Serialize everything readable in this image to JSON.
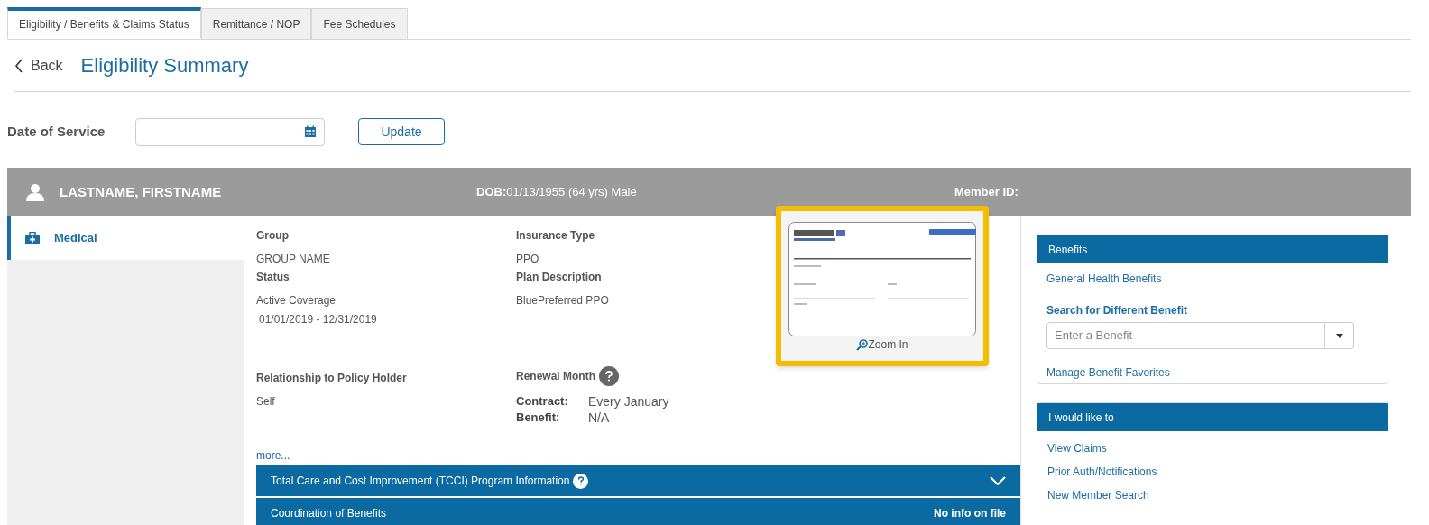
{
  "tabs": [
    {
      "label": "Eligibility / Benefits & Claims Status",
      "selected": true
    },
    {
      "label": "Remittance / NOP",
      "selected": false
    },
    {
      "label": "Fee Schedules",
      "selected": false
    }
  ],
  "header": {
    "back": "Back",
    "title": "Eligibility Summary"
  },
  "date_of_service": {
    "label": "Date of Service",
    "button": "Update"
  },
  "member": {
    "name": "LASTNAME, FIRSTNAME",
    "dob_label": "DOB:",
    "dob": "01/13/1955 (64 yrs) Male",
    "member_id_label": "Member ID:"
  },
  "sidebar": {
    "items": [
      {
        "label": "Medical",
        "selected": true
      }
    ]
  },
  "details": {
    "fields": [
      {
        "label": "Group",
        "value": "GROUP NAME"
      },
      {
        "label": "Insurance Type",
        "value": "PPO"
      },
      {
        "label": "Status",
        "value": "Active Coverage",
        "value_2": "01/01/2019 - 12/31/2019"
      },
      {
        "label": "Plan Description",
        "value": "BluePreferred PPO"
      },
      {
        "label": "Relationship to Policy Holder",
        "value": "Self"
      }
    ],
    "renewal": {
      "label": "Renewal Month",
      "rows": [
        {
          "label": "Contract:",
          "value": "Every January"
        },
        {
          "label": "Benefit:",
          "value": "N/A"
        }
      ]
    },
    "more": "more...",
    "card": {
      "kind": "picture",
      "zoom": "Zoom In"
    },
    "sections": [
      {
        "title": "Total Care and Cost Improvement (TCCI) Program Information",
        "help": true,
        "expanded": false
      },
      {
        "title": "Coordination of Benefits",
        "status": "No info on file"
      }
    ]
  },
  "benefits": {
    "title": "Benefits",
    "link": "General Health Benefits",
    "search_label": "Search for Different Benefit",
    "placeholder": "Enter a Benefit",
    "manage": "Manage Benefit Favorites"
  },
  "actions": {
    "title": "I would like to",
    "links": [
      "View Claims",
      "Prior Auth/Notifications",
      "New Member Search"
    ]
  }
}
